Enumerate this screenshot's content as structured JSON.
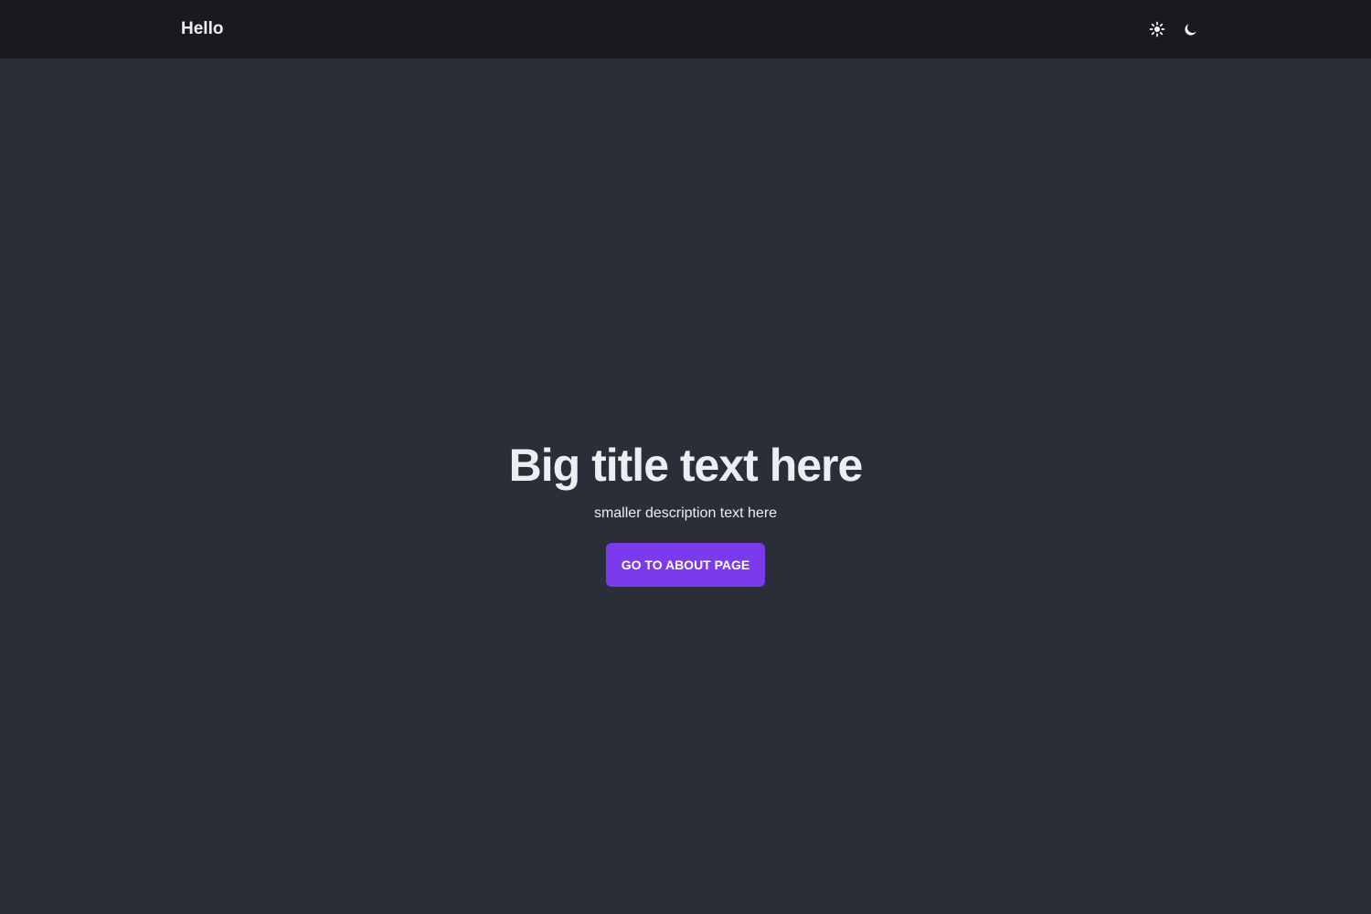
{
  "navbar": {
    "brand": "Hello",
    "toggles": [
      {
        "name": "light-mode",
        "icon": "sun-icon"
      },
      {
        "name": "dark-mode",
        "icon": "moon-icon"
      }
    ]
  },
  "hero": {
    "title": "Big title text here",
    "description": "smaller description text here",
    "cta_label": "GO TO ABOUT PAGE"
  },
  "colors": {
    "page_background": "#2a2e38",
    "navbar_background": "#191a1f",
    "accent": "#7c3aed",
    "text": "#eceef1"
  }
}
